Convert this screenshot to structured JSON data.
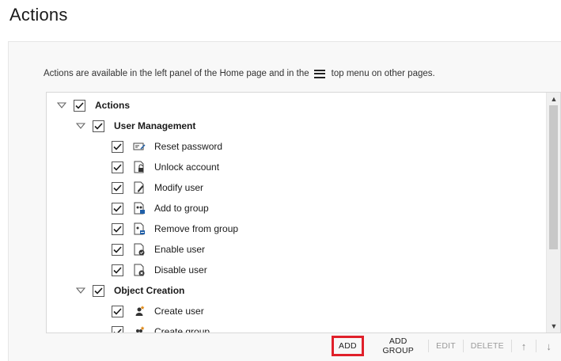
{
  "page": {
    "title": "Actions"
  },
  "info": {
    "before": "Actions are available in the left panel of the Home page and in the",
    "after": "top menu on other pages."
  },
  "tree": {
    "root": {
      "label": "Actions",
      "checked": true,
      "expanded": true
    },
    "groups": [
      {
        "label": "User Management",
        "items": [
          {
            "label": "Reset password",
            "icon": "reset-password-icon"
          },
          {
            "label": "Unlock account",
            "icon": "unlock-account-icon"
          },
          {
            "label": "Modify user",
            "icon": "modify-user-icon"
          },
          {
            "label": "Add to group",
            "icon": "add-to-group-icon"
          },
          {
            "label": "Remove from group",
            "icon": "remove-from-group-icon"
          },
          {
            "label": "Enable user",
            "icon": "enable-user-icon"
          },
          {
            "label": "Disable user",
            "icon": "disable-user-icon"
          }
        ]
      },
      {
        "label": "Object Creation",
        "items": [
          {
            "label": "Create user",
            "icon": "create-user-icon"
          },
          {
            "label": "Create group",
            "icon": "create-group-icon"
          }
        ]
      }
    ]
  },
  "toolbar": {
    "add": "ADD",
    "add_group": "ADD GROUP",
    "edit": "EDIT",
    "delete": "DELETE",
    "up": "↑",
    "down": "↓"
  },
  "colors": {
    "highlight": "#e0202a",
    "check": "#1a1a1a",
    "accent": "#1f5fa8",
    "creation": "#e08a1a"
  }
}
